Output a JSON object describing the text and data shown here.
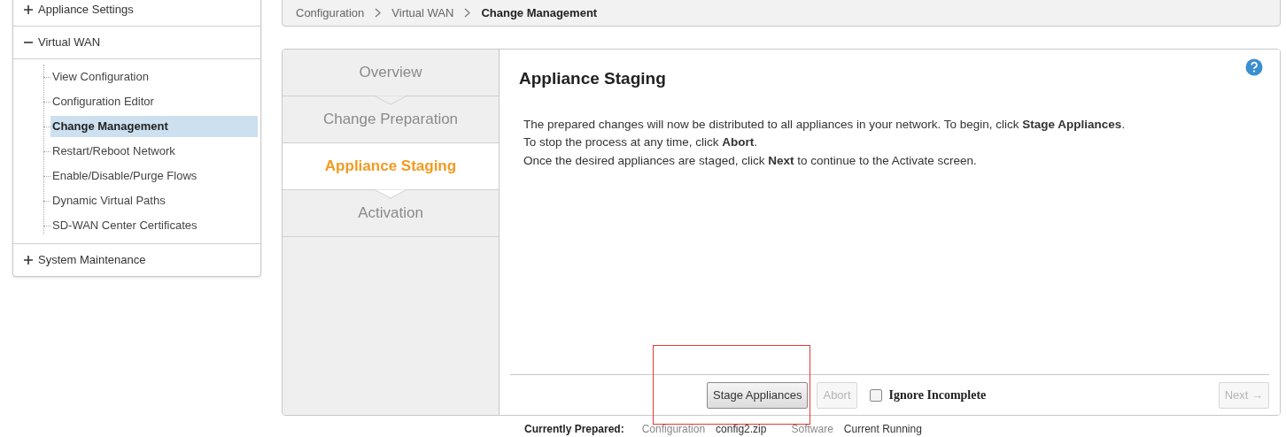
{
  "sidebar": {
    "items": [
      {
        "label": "Appliance Settings",
        "expanded": false
      },
      {
        "label": "Virtual WAN",
        "expanded": true,
        "children": [
          {
            "label": "View Configuration",
            "selected": false
          },
          {
            "label": "Configuration Editor",
            "selected": false
          },
          {
            "label": "Change Management",
            "selected": true
          },
          {
            "label": "Restart/Reboot Network",
            "selected": false
          },
          {
            "label": "Enable/Disable/Purge Flows",
            "selected": false
          },
          {
            "label": "Dynamic Virtual Paths",
            "selected": false
          },
          {
            "label": "SD-WAN Center Certificates",
            "selected": false
          }
        ]
      },
      {
        "label": "System Maintenance",
        "expanded": false
      }
    ]
  },
  "breadcrumb": [
    "Configuration",
    "Virtual WAN",
    "Change Management"
  ],
  "steps": [
    {
      "label": "Overview",
      "selected": false
    },
    {
      "label": "Change Preparation",
      "selected": false
    },
    {
      "label": "Appliance Staging",
      "selected": true
    },
    {
      "label": "Activation",
      "selected": false
    }
  ],
  "content": {
    "title": "Appliance Staging",
    "paragraphs": [
      "The prepared changes will now be distributed to all appliances in your network. To begin, click **Stage Appliances**.",
      "To stop the process at any time, click **Abort**.",
      "Once the desired appliances are staged, click **Next** to continue to the Activate screen."
    ]
  },
  "footer": {
    "buttons": [
      {
        "label": "Stage Appliances",
        "disabled": false
      },
      {
        "label": "Abort",
        "disabled": true
      }
    ],
    "checkbox": {
      "label": "Ignore Incomplete",
      "checked": false
    },
    "next": {
      "label": "Next →",
      "disabled": true
    }
  },
  "annotation": {
    "kind": "rectangle",
    "color": "#e53935"
  },
  "status_line": [
    {
      "label": "Currently Prepared:",
      "kind": "heading"
    },
    {
      "label": "Configuration",
      "kind": "key"
    },
    {
      "label": "config2.zip",
      "kind": "value"
    },
    {
      "label": "Software",
      "kind": "key"
    },
    {
      "label": "Current Running",
      "kind": "value"
    }
  ]
}
